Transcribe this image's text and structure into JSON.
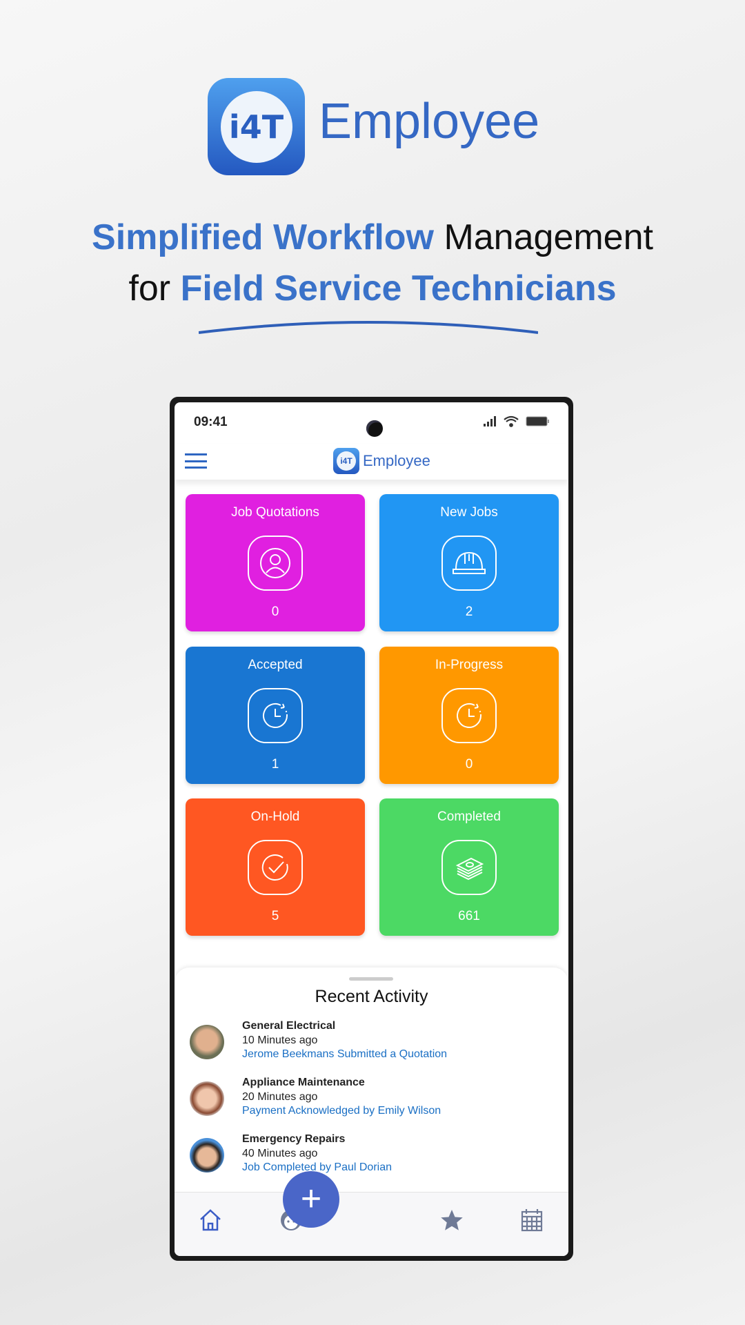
{
  "brand": {
    "name": "Employee",
    "logo_text": "i4T",
    "color": "#3568c4"
  },
  "headline": {
    "line1_highlight": "Simplified Workflow",
    "line1_rest": " Management",
    "line2_prefix": "for ",
    "line2_highlight": "Field Service Technicians"
  },
  "status_bar": {
    "time": "09:41",
    "icons": [
      "signal-icon",
      "wifi-icon",
      "battery-icon"
    ]
  },
  "app_header": {
    "title": "Employee",
    "logo_text": "i4T",
    "menu_icon": "hamburger-icon"
  },
  "cards": [
    {
      "title": "Job Quotations",
      "count": "0",
      "icon": "user-icon",
      "color": "#e020e0"
    },
    {
      "title": "New Jobs",
      "count": "2",
      "icon": "hard-hat-icon",
      "color": "#2196f3"
    },
    {
      "title": "Accepted",
      "count": "1",
      "icon": "clock-icon",
      "color": "#1976d2"
    },
    {
      "title": "In-Progress",
      "count": "0",
      "icon": "clock-icon",
      "color": "#ff9800"
    },
    {
      "title": "On-Hold",
      "count": "5",
      "icon": "check-circle-icon",
      "color": "#ff5722"
    },
    {
      "title": "Completed",
      "count": "661",
      "icon": "money-stack-icon",
      "color": "#4cd964"
    }
  ],
  "recent_activity": {
    "title": "Recent Activity",
    "items": [
      {
        "title": "General Electrical",
        "time": "10 Minutes ago",
        "detail": "Jerome Beekmans Submitted a Quotation"
      },
      {
        "title": "Appliance Maintenance",
        "time": "20 Minutes ago",
        "detail": "Payment Acknowledged by Emily Wilson"
      },
      {
        "title": "Emergency Repairs",
        "time": "40 Minutes ago",
        "detail": "Job Completed by Paul Dorian"
      }
    ]
  },
  "bottom_nav": {
    "items": [
      "home-icon",
      "profile-icon",
      "add-icon",
      "star-icon",
      "calendar-icon"
    ],
    "fab_label": "+"
  }
}
